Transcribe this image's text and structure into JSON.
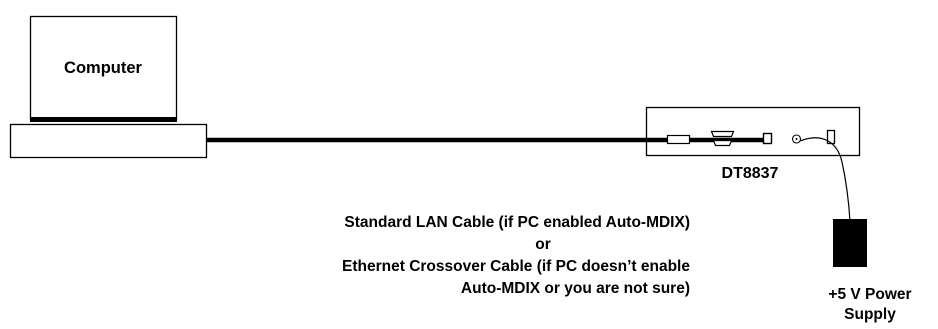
{
  "computer": {
    "label": "Computer"
  },
  "device": {
    "label": "DT8837"
  },
  "cable": {
    "line1": "Standard LAN Cable (if PC enabled Auto-MDIX)",
    "line2": "or",
    "line3": "Ethernet Crossover Cable (if PC doesn’t enable",
    "line4": "Auto-MDIX or you are not sure)"
  },
  "power_supply": {
    "line1": "+5 V Power",
    "line2": "Supply"
  },
  "colors": {
    "stroke": "#000000",
    "background": "#ffffff"
  }
}
